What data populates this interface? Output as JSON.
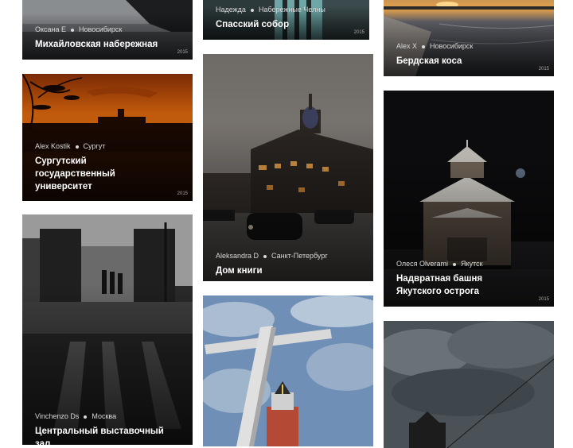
{
  "photos": [
    {
      "author": "Оксана Е",
      "city": "Новосибирск",
      "title": "Михайловская набережная",
      "year": "2015"
    },
    {
      "author": "Надежда",
      "city": "Набережные Челны",
      "title": "Спасский собор",
      "year": "2015"
    },
    {
      "author": "Alex X",
      "city": "Новосибирск",
      "title": "Бердская коса",
      "year": "2015"
    },
    {
      "author": "Alex Kostik",
      "city": "Сургут",
      "title": "Сургутский государственный университет",
      "year": "2015"
    },
    {
      "author": "Aleksandra D",
      "city": "Санкт-Петербург",
      "title": "Дом книги",
      "year": ""
    },
    {
      "author": "Олеся Olverami",
      "city": "Якутск",
      "title": "Надвратная башня Якутского острога",
      "year": "2015"
    },
    {
      "author": "Vinchenzo Ds",
      "city": "Москва",
      "title": "Центральный выставочный зал",
      "year": ""
    },
    {
      "author": "",
      "city": "",
      "title": "",
      "year": ""
    },
    {
      "author": "",
      "city": "",
      "title": "",
      "year": ""
    }
  ]
}
